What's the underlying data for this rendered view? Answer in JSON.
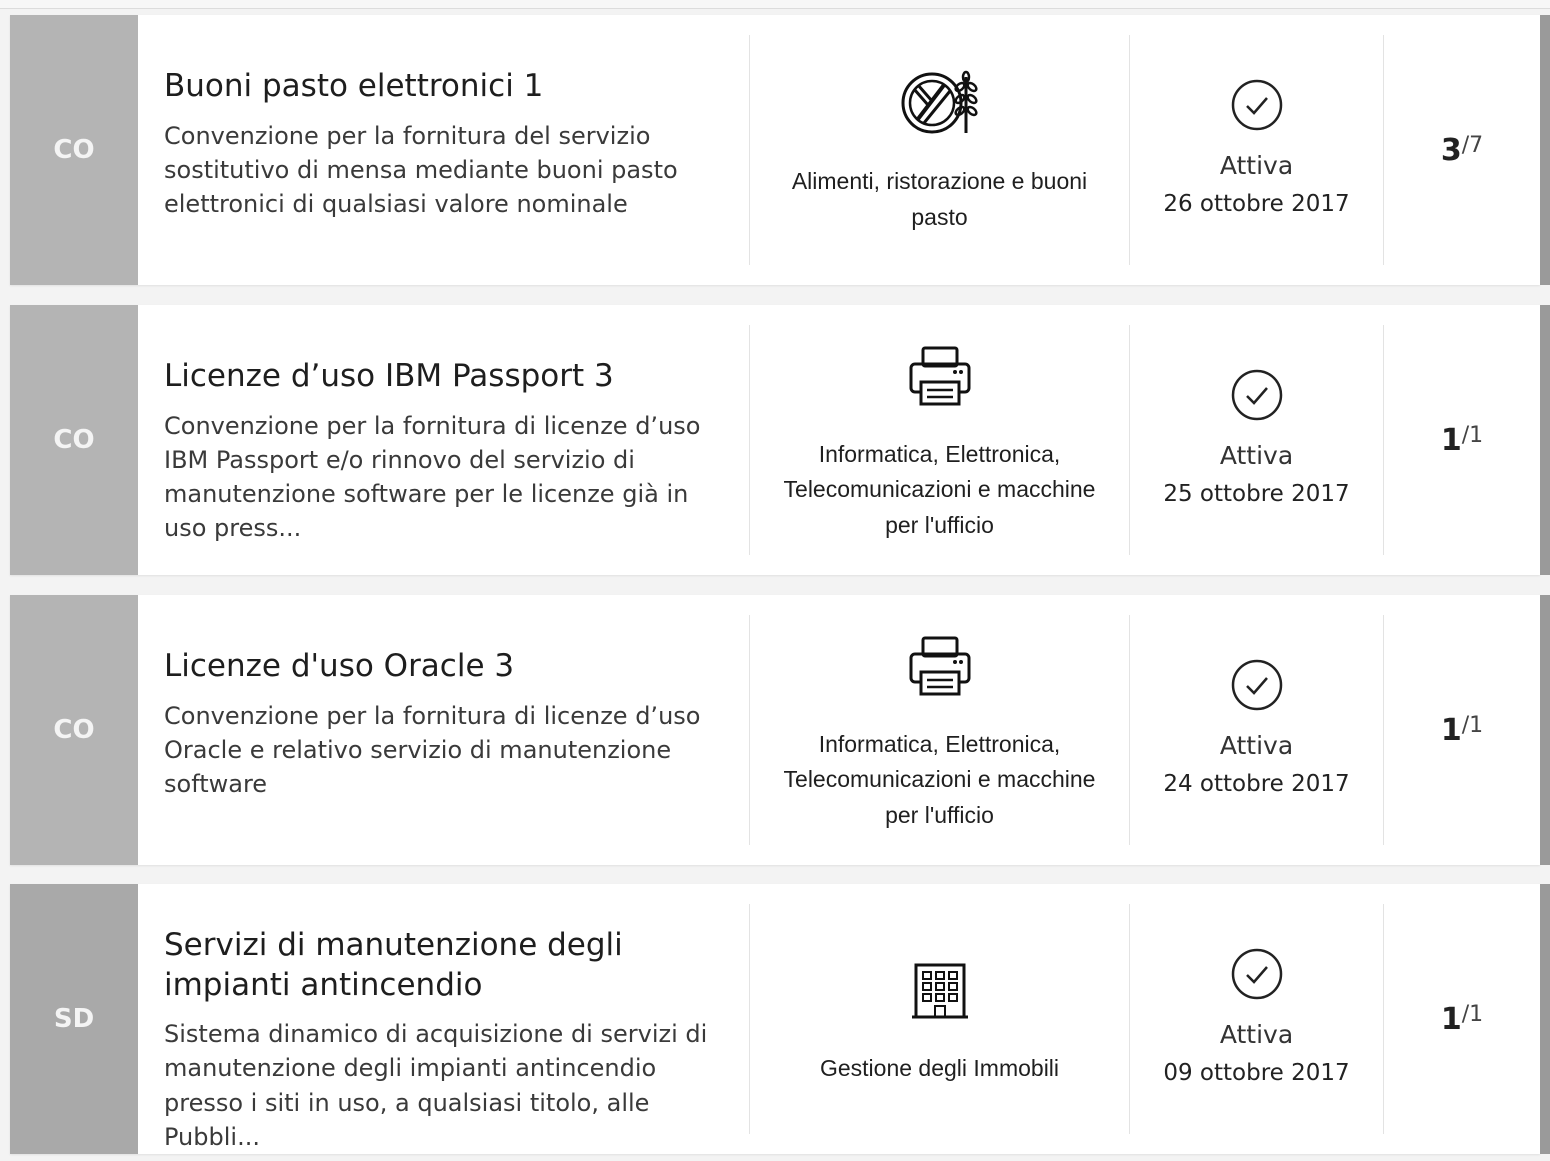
{
  "items": [
    {
      "type_code": "CO",
      "title": "Buoni pasto elettronici 1",
      "description": "Convenzione per la fornitura del servizio sostitutivo di mensa mediante buoni pasto elettronici di qualsiasi valore nominale",
      "category": "Alimenti, ristorazione e buoni pasto",
      "category_icon": "food-wheat-icon",
      "status": "Attiva",
      "date": "26 ottobre 2017",
      "lot_current": "3",
      "lot_sep": "/",
      "lot_total": "7"
    },
    {
      "type_code": "CO",
      "title": "Licenze d’uso IBM Passport 3",
      "description": "Convenzione per la fornitura di licenze d’uso IBM Passport e/o rinnovo del servizio di manutenzione software per le licenze già in uso press...",
      "category": "Informatica, Elettronica, Telecomunicazioni e macchine per l'ufficio",
      "category_icon": "printer-icon",
      "status": "Attiva",
      "date": "25 ottobre 2017",
      "lot_current": "1",
      "lot_sep": "/",
      "lot_total": "1"
    },
    {
      "type_code": "CO",
      "title": "Licenze d'uso Oracle 3",
      "description": "Convenzione per la fornitura di licenze d’uso Oracle e relativo servizio di manutenzione software",
      "category": "Informatica, Elettronica, Telecomunicazioni e macchine per l'ufficio",
      "category_icon": "printer-icon",
      "status": "Attiva",
      "date": "24 ottobre 2017",
      "lot_current": "1",
      "lot_sep": "/",
      "lot_total": "1"
    },
    {
      "type_code": "SD",
      "title": "Servizi di manutenzione degli impianti antincendio",
      "description": "Sistema dinamico di acquisizione di servizi di manutenzione degli impianti antincendio presso i siti in uso, a qualsiasi titolo, alle Pubbli...",
      "category": "Gestione degli Immobili",
      "category_icon": "building-icon",
      "status": "Attiva",
      "date": "09 ottobre 2017",
      "lot_current": "1",
      "lot_sep": "/",
      "lot_total": "1"
    }
  ],
  "colors": {
    "badge_bg": "#b4b4b4",
    "card_bg": "#ffffff",
    "page_bg": "#f3f3f3"
  }
}
